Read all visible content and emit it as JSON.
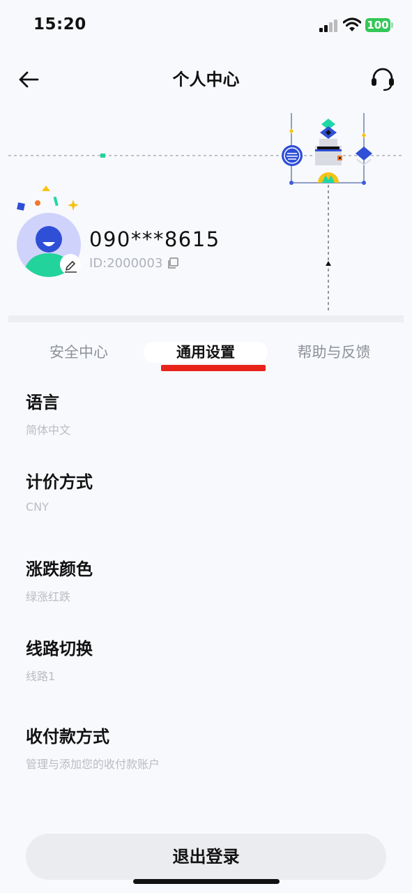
{
  "status_bar": {
    "time": "15:20",
    "battery": "100"
  },
  "header": {
    "title": "个人中心"
  },
  "profile": {
    "phone": "090***8615",
    "id_label": "ID:2000003"
  },
  "tabs": [
    {
      "label": "安全中心",
      "active": false
    },
    {
      "label": "通用设置",
      "active": true
    },
    {
      "label": "帮助与反馈",
      "active": false
    }
  ],
  "settings": [
    {
      "title": "语言",
      "value": "简体中文"
    },
    {
      "title": "计价方式",
      "value": "CNY"
    },
    {
      "title": "涨跌颜色",
      "value": "绿涨红跌"
    },
    {
      "title": "线路切换",
      "value": "线路1"
    },
    {
      "title": "收付款方式",
      "value": "管理与添加您的收付款账户"
    }
  ],
  "logout": {
    "label": "退出登录"
  },
  "colors": {
    "accent_underline": "#e8231a",
    "avatar_green": "#22d39b",
    "avatar_blue": "#2e4fd6",
    "battery": "#34c759"
  }
}
